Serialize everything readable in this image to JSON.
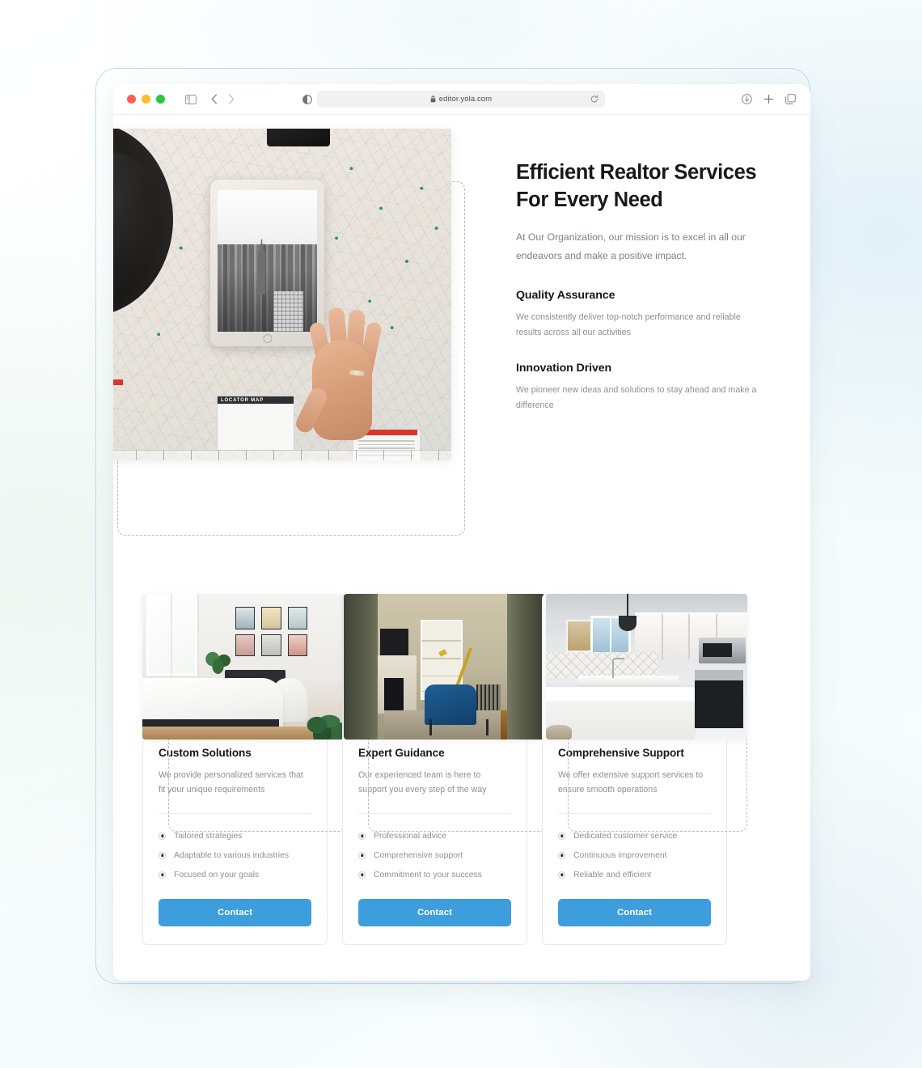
{
  "browser": {
    "url": "editor.yola.com",
    "lock_icon": "lock-icon",
    "traffic_lights": [
      "close-red",
      "minimize-yellow",
      "maximize-green"
    ],
    "icons": {
      "sidebar": "sidebar-toggle-icon",
      "back": "chevron-left-icon",
      "forward": "chevron-right-icon",
      "reader": "reader-view-icon",
      "reload": "reload-icon",
      "download": "download-icon",
      "new_tab": "plus-icon",
      "tabs": "tab-overview-icon"
    }
  },
  "hero": {
    "heading": "Efficient Realtor Services For Every Need",
    "subtitle": "At Our Organization, our mission is to excel in all our endeavors and make a positive impact.",
    "image_alt": "map-with-tablet-and-hand-photo",
    "features": [
      {
        "title": "Quality Assurance",
        "text": "We consistently deliver top-notch performance and reliable results across all our activities"
      },
      {
        "title": "Innovation Driven",
        "text": "We pioneer new ideas and solutions to stay ahead and make a difference"
      }
    ]
  },
  "cards": [
    {
      "image_alt": "bedroom-interior-photo",
      "title": "Custom Solutions",
      "desc": "We provide personalized services that fit your unique requirements",
      "list": [
        "Tailored strategies",
        "Adaptable to various industries",
        "Focused on your goals"
      ],
      "button": "Contact"
    },
    {
      "image_alt": "living-room-blue-armchair-photo",
      "title": "Expert Guidance",
      "desc": "Our experienced team is here to support you every step of the way",
      "list": [
        "Professional advice",
        "Comprehensive support",
        "Commitment to your success"
      ],
      "button": "Contact"
    },
    {
      "image_alt": "white-kitchen-interior-photo",
      "title": "Comprehensive Support",
      "desc": "We offer extensive support services to ensure smooth operations",
      "list": [
        "Dedicated customer service",
        "Continuous improvement",
        "Reliable and efficient"
      ],
      "button": "Contact"
    }
  ],
  "colors": {
    "accent_blue": "#3d9ddd",
    "frame_blue": "#bfdcee",
    "heading": "#16181c",
    "body_text": "#8b9098",
    "selection_dash": "#b9bcc0"
  }
}
